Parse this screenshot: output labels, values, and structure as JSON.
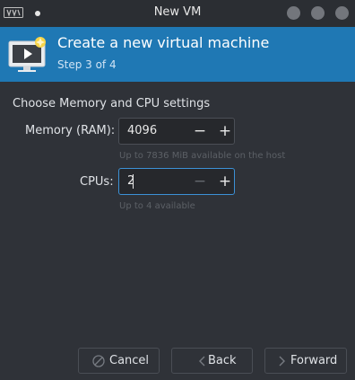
{
  "window": {
    "title": "New VM",
    "controls": [
      "minimize-button",
      "maximize-button",
      "close-button"
    ]
  },
  "banner": {
    "title": "Create a new virtual machine",
    "step": "Step 3 of 4",
    "icon": "monitor-new-icon",
    "background": "#1f78b4"
  },
  "section": {
    "heading": "Choose Memory and CPU settings"
  },
  "memory": {
    "label": "Memory (RAM):",
    "value": "4096",
    "hint": "Up to 7836 MiB available on the host"
  },
  "cpus": {
    "label": "CPUs:",
    "value": "2",
    "hint": "Up to 4 available"
  },
  "buttons": {
    "cancel": "Cancel",
    "back": "Back",
    "forward": "Forward"
  },
  "colors": {
    "accent": "#3c91d6",
    "window_bg": "#2f3238"
  }
}
